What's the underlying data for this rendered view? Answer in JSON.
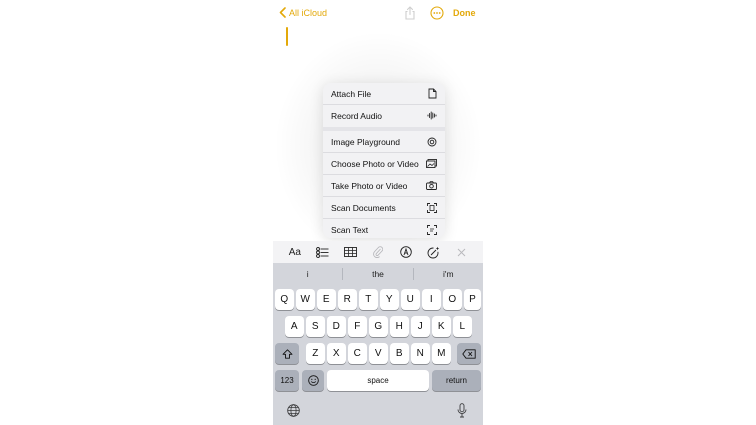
{
  "nav": {
    "back_label": "All iCloud",
    "done_label": "Done"
  },
  "menu": {
    "items": [
      {
        "label": "Attach File",
        "icon": "document-icon"
      },
      {
        "label": "Record Audio",
        "icon": "waveform-icon"
      },
      {
        "label": "Image Playground",
        "icon": "playground-icon"
      },
      {
        "label": "Choose Photo or Video",
        "icon": "photos-icon"
      },
      {
        "label": "Take Photo or Video",
        "icon": "camera-icon"
      },
      {
        "label": "Scan Documents",
        "icon": "scan-document-icon"
      },
      {
        "label": "Scan Text",
        "icon": "scan-text-icon"
      }
    ]
  },
  "toolbar": {
    "format_label": "Aa",
    "icons": [
      "checklist-icon",
      "table-icon",
      "paperclip-icon",
      "markup-icon",
      "sparkle-icon",
      "close-icon"
    ]
  },
  "keyboard": {
    "suggestions": [
      "i",
      "the",
      "i'm"
    ],
    "row1": [
      "Q",
      "W",
      "E",
      "R",
      "T",
      "Y",
      "U",
      "I",
      "O",
      "P"
    ],
    "row2": [
      "A",
      "S",
      "D",
      "F",
      "G",
      "H",
      "J",
      "K",
      "L"
    ],
    "row3": [
      "Z",
      "X",
      "C",
      "V",
      "B",
      "N",
      "M"
    ],
    "numbers_label": "123",
    "space_label": "space",
    "return_label": "return"
  },
  "colors": {
    "accent": "#e3a90a",
    "keyboard_bg": "#d3d5db"
  }
}
